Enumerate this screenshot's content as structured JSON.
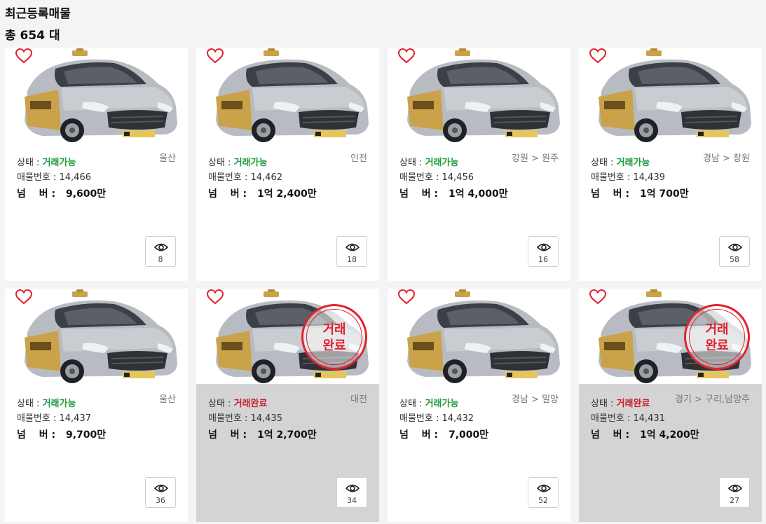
{
  "page": {
    "title": "최근등록매물",
    "total": "총 654 대"
  },
  "labels": {
    "status": "상태 : ",
    "listing_no": "매물번호 : ",
    "price_prefix": "넘　 버 : ",
    "stamp": "거래\n완료"
  },
  "listings": [
    {
      "status": "거래가능",
      "sold": false,
      "region": "울산",
      "number": "14,466",
      "price": "9,600만",
      "views": "8"
    },
    {
      "status": "거래가능",
      "sold": false,
      "region": "인천",
      "number": "14,462",
      "price": "1억 2,400만",
      "views": "18"
    },
    {
      "status": "거래가능",
      "sold": false,
      "region": "강원 > 원주",
      "number": "14,456",
      "price": "1억 4,000만",
      "views": "16"
    },
    {
      "status": "거래가능",
      "sold": false,
      "region": "경남 > 창원",
      "number": "14,439",
      "price": "1억 700만",
      "views": "58"
    },
    {
      "status": "거래가능",
      "sold": false,
      "region": "울산",
      "number": "14,437",
      "price": "9,700만",
      "views": "36"
    },
    {
      "status": "거래완료",
      "sold": true,
      "region": "대전",
      "number": "14,435",
      "price": "1억 2,700만",
      "views": "34"
    },
    {
      "status": "거래가능",
      "sold": false,
      "region": "경남 > 밀양",
      "number": "14,432",
      "price": "7,000만",
      "views": "52"
    },
    {
      "status": "거래완료",
      "sold": true,
      "region": "경기 > 구리,남양주",
      "number": "14,431",
      "price": "1억 4,200만",
      "views": "27"
    }
  ],
  "colors": {
    "available": "#1f9a3f",
    "sold": "#c8202b",
    "heart": "#e0222f",
    "sold_card_bg": "#d4d4d4"
  },
  "icons": {
    "favorite": "heart-icon",
    "views": "eye-icon",
    "sold_stamp": "sold-stamp"
  }
}
